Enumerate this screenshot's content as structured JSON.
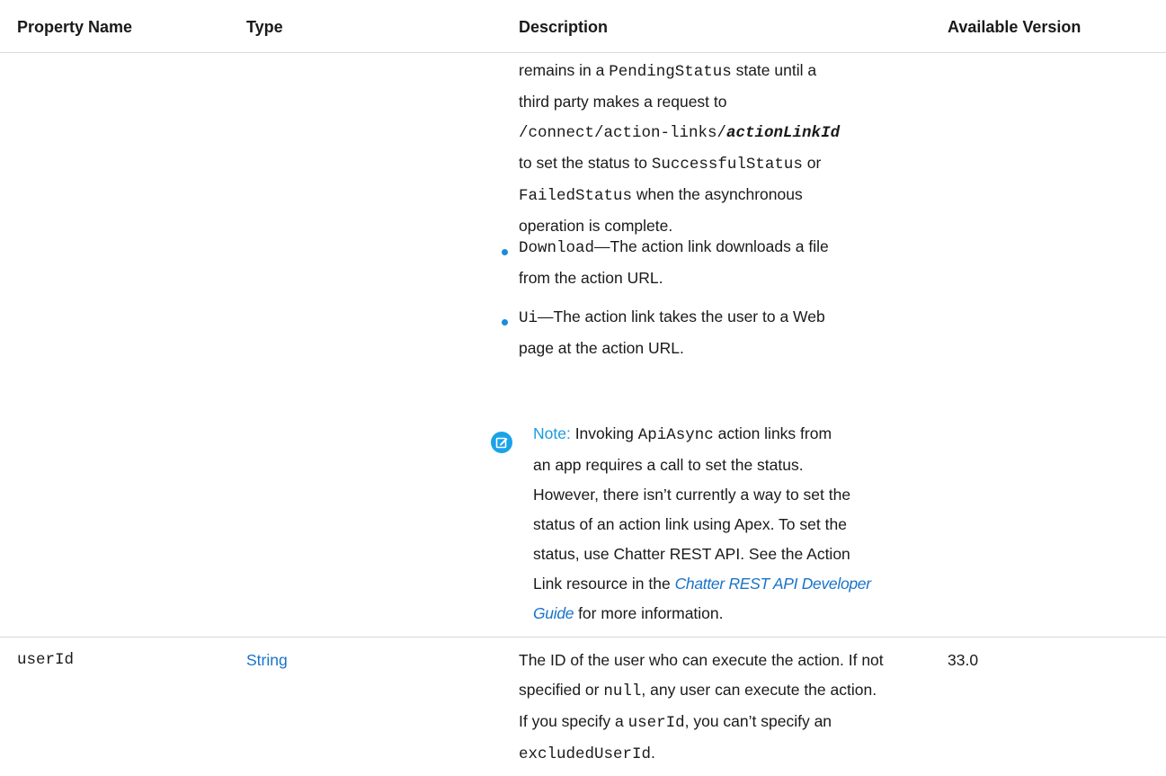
{
  "headers": {
    "property_name": "Property Name",
    "type": "Type",
    "description": "Description",
    "available_version": "Available Version"
  },
  "row1": {
    "para": {
      "l1_a": "remains in a ",
      "l1_code": "PendingStatus",
      "l1_b": " state until a",
      "l2": "third party makes a request to",
      "l3_code": "/connect/action-links/",
      "l3_var": "actionLinkId",
      "l4_a": "to set the status to ",
      "l4_code": "SuccessfulStatus",
      "l4_b": " or",
      "l5_code": "FailedStatus",
      "l5_b": " when the asynchronous",
      "l6": "operation is complete."
    },
    "bullets": [
      {
        "code": "Download",
        "text_l1": "—The action link downloads a file",
        "text_l2": "from the action URL."
      },
      {
        "code": "Ui",
        "text_l1": "—The action link takes the user to a Web",
        "text_l2": "page at the action URL."
      }
    ],
    "note": {
      "icon": "note-edit-icon",
      "label": "Note:",
      "l1_a": " Invoking ",
      "l1_code": "ApiAsync",
      "l1_b": " action links from",
      "l2": "an app requires a call to set the status.",
      "l3": "However, there isn’t currently a way to set the",
      "l4": "status of an action link using Apex. To set the",
      "l5": "status, use Chatter REST API. See the Action",
      "l6_a": "Link resource in the ",
      "l6_link": "Chatter REST API Developer",
      "l7_link": "Guide",
      "l7_b": " for more information."
    }
  },
  "row2": {
    "property": "userId",
    "type": "String",
    "version": "33.0",
    "desc": {
      "l1": "The ID of the user who can execute the action. If not",
      "l2_a": "specified or ",
      "l2_code": "null",
      "l2_b": ", any user can execute the action.",
      "l3_a": "If you specify a ",
      "l3_code": "userId",
      "l3_b": ", you can’t specify an",
      "l4_code": "excludedUserId",
      "l4_b": "."
    }
  },
  "colors": {
    "link": "#1a73c8",
    "note_accent": "#1aa3e8",
    "bullet": "#1a8cd8",
    "divider": "#d9d9d9"
  }
}
